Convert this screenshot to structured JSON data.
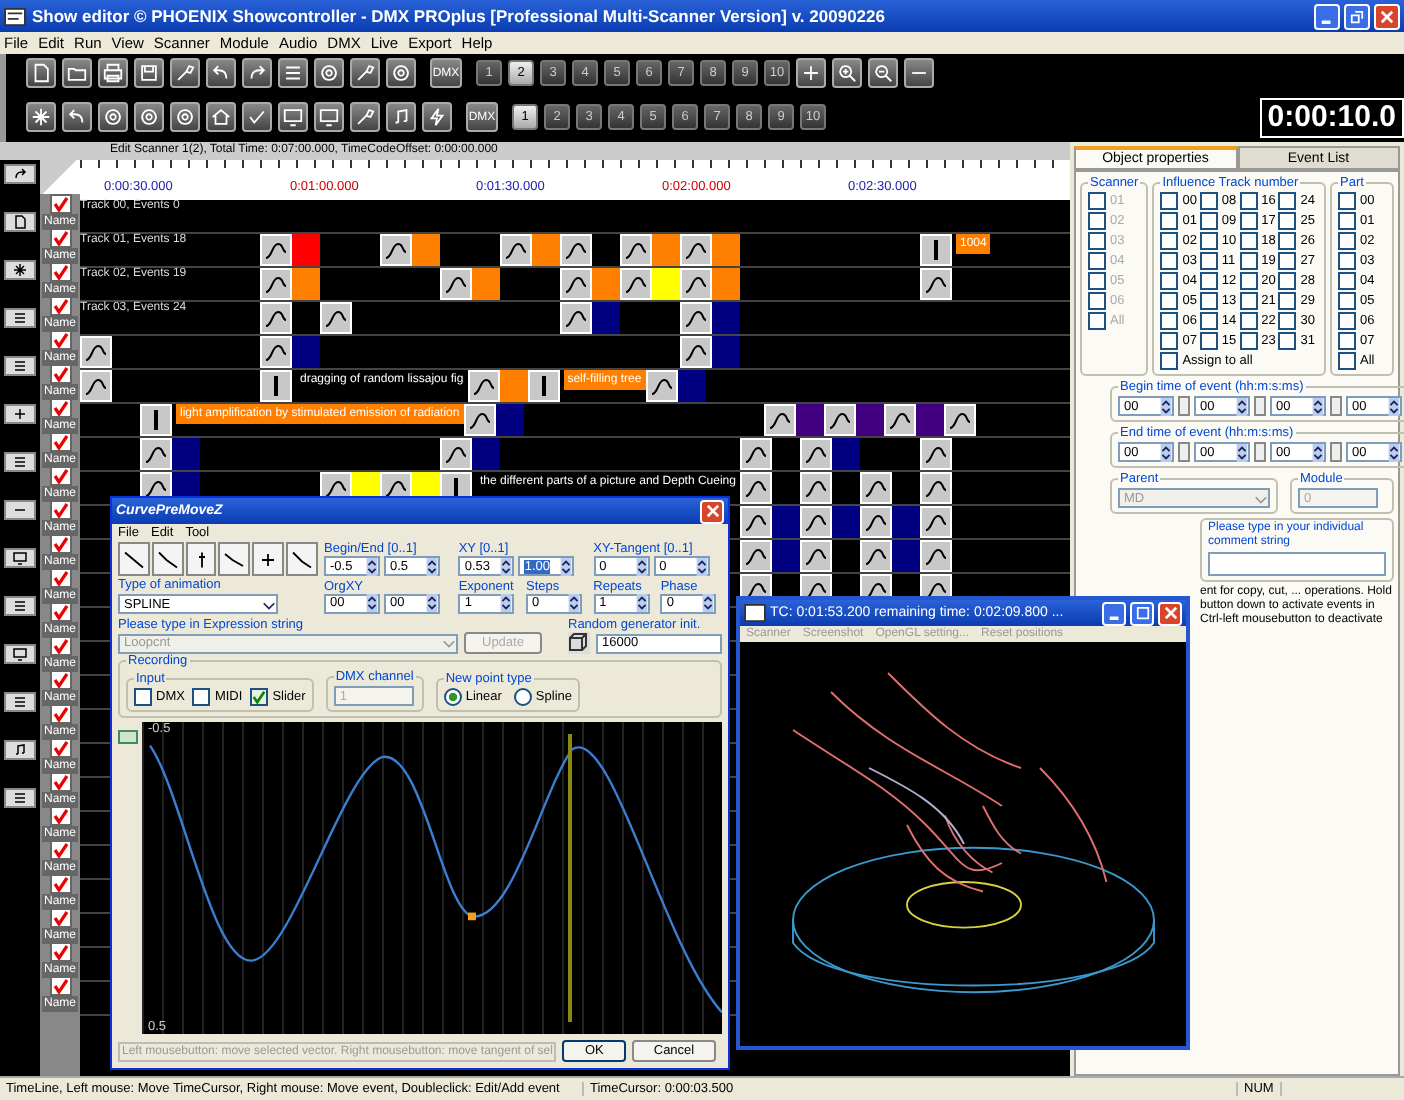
{
  "window": {
    "title": "Show editor © PHOENIX Showcontroller - DMX PROplus [Professional Multi-Scanner Version] v. 20090226"
  },
  "menu": [
    "File",
    "Edit",
    "Run",
    "View",
    "Scanner",
    "Module",
    "Audio",
    "DMX",
    "Live",
    "Export",
    "Help"
  ],
  "toolbar": {
    "row_1": {
      "dmx_label": "DMX",
      "numbers": [
        {
          "label": "1",
          "selected": false
        },
        {
          "label": "2",
          "selected": true
        },
        {
          "label": "3",
          "selected": false
        },
        {
          "label": "4",
          "selected": false
        },
        {
          "label": "5",
          "selected": false
        },
        {
          "label": "6",
          "selected": false
        },
        {
          "label": "7",
          "selected": false
        },
        {
          "label": "8",
          "selected": false
        },
        {
          "label": "9",
          "selected": false
        },
        {
          "label": "10",
          "selected": false
        }
      ]
    },
    "row_2": {
      "dmx_label": "DMX",
      "numbers": [
        {
          "label": "1",
          "selected": true
        },
        {
          "label": "2",
          "selected": false
        },
        {
          "label": "3",
          "selected": false
        },
        {
          "label": "4",
          "selected": false
        },
        {
          "label": "5",
          "selected": false
        },
        {
          "label": "6",
          "selected": false
        },
        {
          "label": "7",
          "selected": false
        },
        {
          "label": "8",
          "selected": false
        },
        {
          "label": "9",
          "selected": false
        },
        {
          "label": "10",
          "selected": false
        }
      ]
    },
    "timer": "0:00:10.0"
  },
  "editor": {
    "header": "Edit Scanner 1(2), Total Time: 0:07:00.000, TimeCodeOffset: 0:00:00.000",
    "ruler": [
      {
        "label": "0:00:30.000",
        "kind": "half"
      },
      {
        "label": "0:01:00.000",
        "kind": "minute"
      },
      {
        "label": "0:01:30.000",
        "kind": "half"
      },
      {
        "label": "0:02:00.000",
        "kind": "minute"
      },
      {
        "label": "0:02:30.000",
        "kind": "half"
      }
    ],
    "tracks": [
      {
        "label": "Track 00, Events 0",
        "checked": true,
        "button": "Name"
      },
      {
        "label": "Track 01, Events 18",
        "checked": true,
        "button": "Name",
        "cells": [
          {
            "kind": "event",
            "color": "#ff0000"
          },
          {
            "kind": "gap"
          },
          {
            "kind": "event",
            "color": "#ff8000"
          },
          {
            "kind": "gap"
          },
          {
            "kind": "event",
            "color": "#ff8000"
          },
          {
            "kind": "event"
          },
          {
            "kind": "event",
            "color": "#ff8000"
          },
          {
            "kind": "event",
            "color": "#ff8000"
          },
          {
            "kind": "gap"
          },
          {
            "kind": "gap"
          },
          {
            "kind": "gap"
          },
          {
            "kind": "text_event",
            "text": "1004",
            "color": "#ff8000"
          }
        ]
      },
      {
        "label": "Track 02, Events 19",
        "checked": true,
        "button": "Name",
        "cells": [
          {
            "kind": "event",
            "color": "#ff8000"
          },
          {
            "kind": "gap"
          },
          {
            "kind": "gap"
          },
          {
            "kind": "event",
            "color": "#ff8000"
          },
          {
            "kind": "gap"
          },
          {
            "kind": "event",
            "color": "#ff8000"
          },
          {
            "kind": "event",
            "color": "#ffff00"
          },
          {
            "kind": "event",
            "color": "#ff8000"
          },
          {
            "kind": "gap"
          },
          {
            "kind": "gap"
          },
          {
            "kind": "gap"
          },
          {
            "kind": "event"
          }
        ]
      },
      {
        "label": "Track 03, Events 24",
        "checked": true,
        "button": "Name",
        "cells": [
          {
            "kind": "event"
          },
          {
            "kind": "event"
          },
          {
            "kind": "gap"
          },
          {
            "kind": "gap"
          },
          {
            "kind": "gap"
          },
          {
            "kind": "event",
            "color": "#000080"
          },
          {
            "kind": "gap"
          },
          {
            "kind": "event",
            "color": "#000080"
          }
        ]
      },
      {
        "checked": true,
        "button": "Name",
        "cells": [
          {
            "kind": "event"
          },
          {
            "kind": "gap"
          },
          {
            "kind": "gap"
          },
          {
            "kind": "event",
            "color": "#000080"
          },
          {
            "kind": "gap"
          },
          {
            "kind": "gap"
          },
          {
            "kind": "gap"
          },
          {
            "kind": "gap"
          },
          {
            "kind": "gap"
          },
          {
            "kind": "gap"
          },
          {
            "kind": "event",
            "color": "#000080"
          }
        ]
      },
      {
        "checked": true,
        "button": "Name",
        "cells": [
          {
            "kind": "event"
          },
          {
            "kind": "gap"
          },
          {
            "kind": "gap"
          },
          {
            "kind": "text_event",
            "text": "dragging of random lissajou fig"
          },
          {
            "kind": "event",
            "color": "#ff8000"
          },
          {
            "kind": "text_event",
            "text": "self-filling tree",
            "color": "#ff8000"
          },
          {
            "kind": "event",
            "color": "#000080"
          }
        ]
      },
      {
        "checked": true,
        "button": "Name",
        "cells": [
          {
            "kind": "gap"
          },
          {
            "kind": "text_event",
            "text": "light amplification by stimulated emission of radiation",
            "color": "#ff8000"
          },
          {
            "kind": "event",
            "color": "#000080"
          },
          {
            "kind": "gap"
          },
          {
            "kind": "gap"
          },
          {
            "kind": "gap"
          },
          {
            "kind": "gap"
          },
          {
            "kind": "event",
            "color": "#400080"
          },
          {
            "kind": "event",
            "color": "#400080"
          },
          {
            "kind": "event",
            "color": "#400080"
          },
          {
            "kind": "event"
          }
        ]
      },
      {
        "checked": true,
        "button": "Name",
        "cells": [
          {
            "kind": "gap"
          },
          {
            "kind": "event",
            "color": "#000080"
          },
          {
            "kind": "gap"
          },
          {
            "kind": "gap"
          },
          {
            "kind": "gap"
          },
          {
            "kind": "gap"
          },
          {
            "kind": "event",
            "color": "#000080"
          },
          {
            "kind": "gap"
          },
          {
            "kind": "gap"
          },
          {
            "kind": "gap"
          },
          {
            "kind": "gap"
          },
          {
            "kind": "event"
          },
          {
            "kind": "event",
            "color": "#000080"
          },
          {
            "kind": "gap"
          },
          {
            "kind": "event"
          }
        ]
      },
      {
        "checked": true,
        "button": "Name",
        "cells": [
          {
            "kind": "gap"
          },
          {
            "kind": "event",
            "color": "#000080"
          },
          {
            "kind": "gap"
          },
          {
            "kind": "gap"
          },
          {
            "kind": "event",
            "color": "#ffff00"
          },
          {
            "kind": "event",
            "color": "#ffff00"
          },
          {
            "kind": "text_event",
            "text": "the different parts of a picture and Depth Cueing"
          },
          {
            "kind": "event"
          },
          {
            "kind": "event"
          },
          {
            "kind": "event"
          },
          {
            "kind": "event"
          }
        ]
      },
      {
        "checked": true,
        "button": "Name",
        "cells": [
          {
            "kind": "gap"
          },
          {
            "kind": "gap"
          },
          {
            "kind": "gap"
          },
          {
            "kind": "gap"
          },
          {
            "kind": "gap"
          },
          {
            "kind": "gap"
          },
          {
            "kind": "gap"
          },
          {
            "kind": "gap"
          },
          {
            "kind": "gap"
          },
          {
            "kind": "gap"
          },
          {
            "kind": "gap"
          },
          {
            "kind": "event",
            "color": "#000080"
          },
          {
            "kind": "event",
            "color": "#000080"
          },
          {
            "kind": "event",
            "color": "#000080"
          },
          {
            "kind": "event"
          }
        ]
      },
      {
        "checked": true,
        "button": "Name",
        "cells": [
          {
            "kind": "gap"
          },
          {
            "kind": "gap"
          },
          {
            "kind": "gap"
          },
          {
            "kind": "gap"
          },
          {
            "kind": "gap"
          },
          {
            "kind": "gap"
          },
          {
            "kind": "gap"
          },
          {
            "kind": "gap"
          },
          {
            "kind": "gap"
          },
          {
            "kind": "gap"
          },
          {
            "kind": "gap"
          },
          {
            "kind": "event",
            "color": "#000080"
          },
          {
            "kind": "event"
          },
          {
            "kind": "event",
            "color": "#000080"
          },
          {
            "kind": "event"
          }
        ]
      },
      {
        "checked": true,
        "button": "Name",
        "cells": [
          {
            "kind": "gap"
          },
          {
            "kind": "gap"
          },
          {
            "kind": "gap"
          },
          {
            "kind": "gap"
          },
          {
            "kind": "gap"
          },
          {
            "kind": "gap"
          },
          {
            "kind": "gap"
          },
          {
            "kind": "gap"
          },
          {
            "kind": "gap"
          },
          {
            "kind": "gap"
          },
          {
            "kind": "gap"
          },
          {
            "kind": "event"
          },
          {
            "kind": "event"
          },
          {
            "kind": "event"
          },
          {
            "kind": "event"
          }
        ]
      },
      {
        "checked": true,
        "button": "Name"
      },
      {
        "checked": true,
        "button": "Name"
      },
      {
        "checked": true,
        "button": "Name"
      },
      {
        "checked": true,
        "button": "Name"
      },
      {
        "checked": true,
        "button": "Name"
      },
      {
        "checked": true,
        "button": "Name"
      },
      {
        "checked": true,
        "button": "Name"
      },
      {
        "checked": true,
        "button": "Name"
      },
      {
        "checked": true,
        "button": "Name"
      },
      {
        "checked": true,
        "button": "Name"
      },
      {
        "checked": true,
        "button": "Name"
      },
      {
        "checked": true,
        "button": "Name"
      }
    ]
  },
  "properties": {
    "tabs": [
      {
        "label": "Object properties",
        "selected": true
      },
      {
        "label": "Event List",
        "selected": false
      }
    ],
    "scanner": {
      "title": "Scanner",
      "items": [
        {
          "label": "01",
          "checked": false
        },
        {
          "label": "02",
          "checked": false
        },
        {
          "label": "03",
          "checked": false
        },
        {
          "label": "04",
          "checked": false
        },
        {
          "label": "05",
          "checked": false
        },
        {
          "label": "06",
          "checked": false
        }
      ],
      "all": {
        "label": "All",
        "checked": false
      }
    },
    "influence": {
      "title": "Influence Track number",
      "items": [
        {
          "label": "00",
          "checked": false
        },
        {
          "label": "08",
          "checked": false
        },
        {
          "label": "16",
          "checked": false
        },
        {
          "label": "24",
          "checked": false
        },
        {
          "label": "01",
          "checked": false
        },
        {
          "label": "09",
          "checked": false
        },
        {
          "label": "17",
          "checked": false
        },
        {
          "label": "25",
          "checked": false
        },
        {
          "label": "02",
          "checked": false
        },
        {
          "label": "10",
          "checked": false
        },
        {
          "label": "18",
          "checked": false
        },
        {
          "label": "26",
          "checked": false
        },
        {
          "label": "03",
          "checked": false
        },
        {
          "label": "11",
          "checked": false
        },
        {
          "label": "19",
          "checked": false
        },
        {
          "label": "27",
          "checked": false
        },
        {
          "label": "04",
          "checked": false
        },
        {
          "label": "12",
          "checked": false
        },
        {
          "label": "20",
          "checked": false
        },
        {
          "label": "28",
          "checked": false
        },
        {
          "label": "05",
          "checked": false
        },
        {
          "label": "13",
          "checked": false
        },
        {
          "label": "21",
          "checked": false
        },
        {
          "label": "29",
          "checked": false
        },
        {
          "label": "06",
          "checked": false
        },
        {
          "label": "14",
          "checked": false
        },
        {
          "label": "22",
          "checked": false
        },
        {
          "label": "30",
          "checked": false
        },
        {
          "label": "07",
          "checked": false
        },
        {
          "label": "15",
          "checked": false
        },
        {
          "label": "23",
          "checked": false
        },
        {
          "label": "31",
          "checked": false
        }
      ],
      "assign": {
        "label": "Assign to all",
        "checked": false
      }
    },
    "part": {
      "title": "Part",
      "items": [
        {
          "label": "00",
          "checked": false
        },
        {
          "label": "01",
          "checked": false
        },
        {
          "label": "02",
          "checked": false
        },
        {
          "label": "03",
          "checked": false
        },
        {
          "label": "04",
          "checked": false
        },
        {
          "label": "05",
          "checked": false
        },
        {
          "label": "06",
          "checked": false
        },
        {
          "label": "07",
          "checked": false
        }
      ],
      "all": {
        "label": "All",
        "checked": false
      }
    },
    "begin_time": {
      "title": "Begin time of event (hh:m:s:ms)",
      "values": [
        "00",
        "00",
        "00",
        "00"
      ]
    },
    "end_time": {
      "title": "End time of event (hh:m:s:ms)",
      "values": [
        "00",
        "00",
        "00",
        "00"
      ]
    },
    "parent": {
      "title": "Parent",
      "value": "MD"
    },
    "module": {
      "title": "Module",
      "value": "0"
    },
    "comment": {
      "title": "Please type in your individual comment string"
    },
    "help": [
      "ent for copy, cut, ... operations. Hold",
      "button down to activate events in",
      "Ctrl-left mousebutton to deactivate"
    ]
  },
  "curve_window": {
    "title": "CurvePreMoveZ",
    "menu": [
      "File",
      "Edit",
      "Tool"
    ],
    "groups": [
      {
        "label": "Begin/End [0..1]",
        "values": [
          {
            "value": "-0.5",
            "highlighted": false
          },
          {
            "value": "0.5",
            "highlighted": false
          }
        ]
      },
      {
        "label": "XY [0..1]",
        "values": [
          {
            "value": "0.53",
            "highlighted": false
          },
          {
            "value": "1.00",
            "highlighted": true
          }
        ]
      },
      {
        "label": "XY-Tangent [0..1]",
        "values": [
          {
            "value": "0",
            "highlighted": false
          },
          {
            "value": "0",
            "highlighted": false
          }
        ]
      },
      {
        "label": "OrgXY",
        "values": [
          {
            "value": "00",
            "highlighted": false
          },
          {
            "value": "00",
            "highlighted": false
          }
        ]
      },
      {
        "label": "Exponent",
        "values": [
          {
            "value": "1",
            "highlighted": false
          }
        ]
      },
      {
        "label": "Steps",
        "values": [
          {
            "value": "0",
            "highlighted": false
          }
        ]
      },
      {
        "label": "Repeats",
        "values": [
          {
            "value": "1",
            "highlighted": false
          }
        ]
      },
      {
        "label": "Phase",
        "values": [
          {
            "value": "0",
            "highlighted": false
          }
        ]
      }
    ],
    "animation": {
      "label": "Type of animation",
      "value": "SPLINE"
    },
    "expression": {
      "label": "Please type in Expression string",
      "value": "Loopcnt",
      "button": "Update"
    },
    "random": {
      "label": "Random generator init.",
      "value": "16000"
    },
    "recording": {
      "title": "Recording",
      "input_title": "Input",
      "inputs": [
        {
          "label": "DMX",
          "checked": false
        },
        {
          "label": "MIDI",
          "checked": false
        },
        {
          "label": "Slider",
          "checked": true
        }
      ],
      "dmx_channel": {
        "label": "DMX channel",
        "value": "1"
      },
      "point_type": {
        "label": "New point type",
        "options": [
          {
            "label": "Linear",
            "selected": true
          },
          {
            "label": "Spline",
            "selected": false
          }
        ]
      }
    },
    "plot": {
      "top_label": "-0.5",
      "bottom_label": "0.5"
    },
    "hint": "Left mousebutton: move selected vector. Right mousebutton: move tangent of sel",
    "buttons": [
      "OK",
      "Cancel"
    ]
  },
  "preview_window": {
    "title": "TC: 0:01:53.200 remaining time: 0:02:09.800 ...",
    "menu": [
      "Scanner",
      "Screenshot",
      "OpenGL setting...",
      "Reset positions"
    ]
  },
  "status_bar": [
    "TimeLine, Left mouse: Move TimeCursor, Right mouse: Move event, Doubleclick: Edit/Add event",
    "TimeCursor: 0:00:03.500",
    "NUM"
  ]
}
